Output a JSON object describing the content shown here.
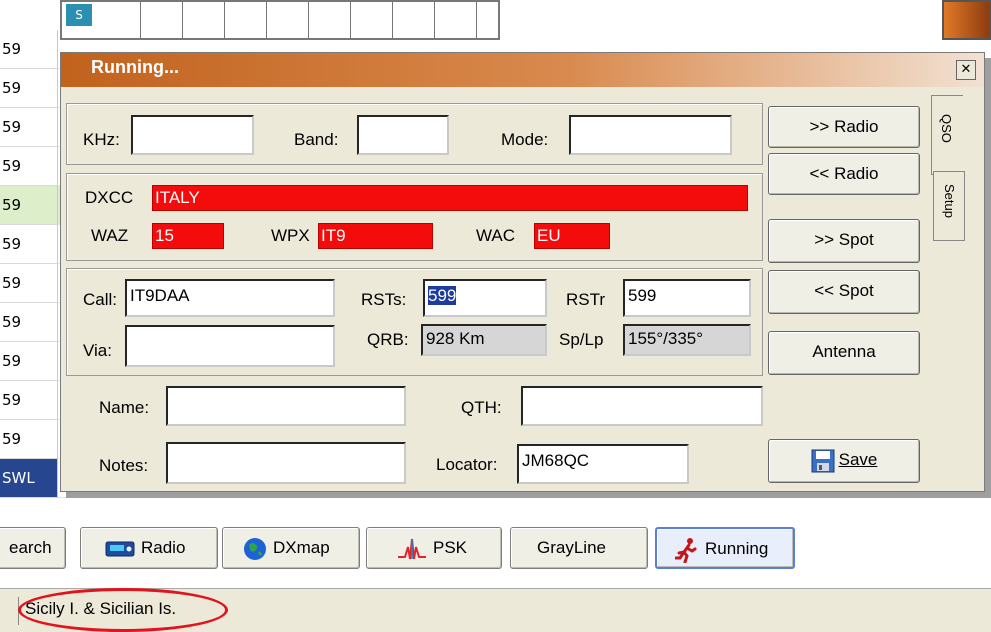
{
  "background": {
    "row_labels": [
      "59",
      "59",
      "59",
      "59",
      "59",
      "59",
      "59",
      "59",
      "59",
      "59",
      "59",
      "SWL"
    ],
    "top_badge": "S"
  },
  "dialog": {
    "title": "Running...",
    "close_glyph": "✕",
    "freq": {
      "khz_label": "KHz:",
      "khz_value": "",
      "band_label": "Band:",
      "band_value": "",
      "mode_label": "Mode:",
      "mode_value": ""
    },
    "dxcc": {
      "dxcc_label": "DXCC",
      "dxcc_value": "ITALY",
      "waz_label": "WAZ",
      "waz_value": "15",
      "wpx_label": "WPX",
      "wpx_value": "IT9",
      "wac_label": "WAC",
      "wac_value": "EU"
    },
    "qso": {
      "call_label": "Call:",
      "call_value": "IT9DAA",
      "rsts_label": "RSTs:",
      "rsts_value": "599",
      "rstr_label": "RSTr",
      "rstr_value": "599",
      "via_label": "Via:",
      "via_value": "",
      "qrb_label": "QRB:",
      "qrb_value": "928 Km",
      "splp_label": "Sp/Lp",
      "splp_value": "155°/335°"
    },
    "info": {
      "name_label": "Name:",
      "name_value": "",
      "qth_label": "QTH:",
      "qth_value": "",
      "notes_label": "Notes:",
      "notes_value": "",
      "locator_label": "Locator:",
      "locator_value": "JM68QC"
    },
    "buttons": {
      "to_radio": ">> Radio",
      "from_radio": "<< Radio",
      "to_spot": ">> Spot",
      "from_spot": "<< Spot",
      "antenna": "Antenna",
      "save": "Save"
    },
    "tabs": {
      "qso": "QSO",
      "setup": "Setup"
    }
  },
  "toolbar": {
    "search": "earch",
    "radio": "Radio",
    "dxmap": "DXmap",
    "psk": "PSK",
    "grayline": "GrayLine",
    "running": "Running"
  },
  "status": {
    "text": "Sicily I. & Sicilian Is."
  },
  "colors": {
    "accent_red": "#f40c0c",
    "title_orange": "#c1621d",
    "annotation": "#e1141d"
  }
}
